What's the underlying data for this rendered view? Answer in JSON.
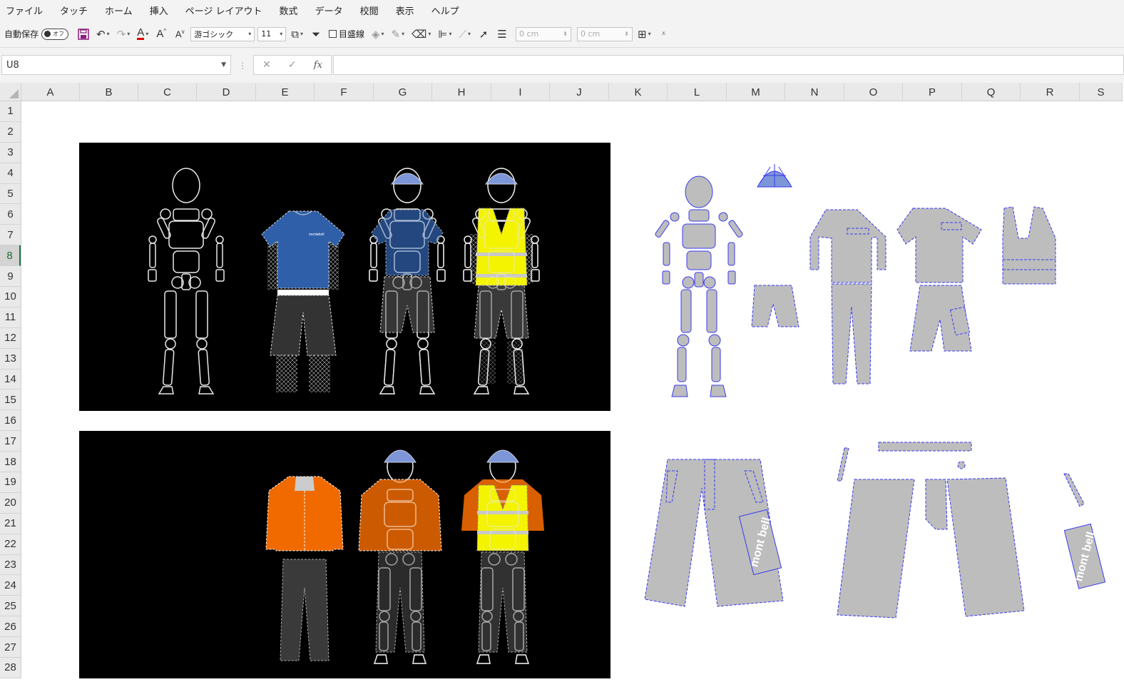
{
  "menu": {
    "items": [
      "ファイル",
      "タッチ",
      "ホーム",
      "挿入",
      "ページ レイアウト",
      "数式",
      "データ",
      "校閲",
      "表示",
      "ヘルプ"
    ]
  },
  "ribbon": {
    "autosave_label": "自動保存",
    "autosave_state": "オフ",
    "font_name": "游ゴシック",
    "font_size": "11",
    "gridlines_label": "目盛線",
    "width_value": "0 cm",
    "height_value": "0 cm",
    "font_color": "#e00000"
  },
  "formula_bar": {
    "name_box": "U8",
    "formula": ""
  },
  "grid": {
    "columns": [
      "A",
      "B",
      "C",
      "D",
      "E",
      "F",
      "G",
      "H",
      "I",
      "J",
      "K",
      "L",
      "M",
      "N",
      "O",
      "P",
      "Q",
      "R",
      "S"
    ],
    "rows": [
      "1",
      "2",
      "3",
      "4",
      "5",
      "6",
      "7",
      "8",
      "9",
      "10",
      "11",
      "12",
      "13",
      "14",
      "15",
      "16",
      "17",
      "18",
      "19",
      "20",
      "21",
      "22",
      "23",
      "24",
      "25",
      "26",
      "27",
      "28"
    ],
    "active_row": "8"
  },
  "drawings": {
    "brand_logo_text": "mont bell",
    "colors": {
      "panel_bg": "#000000",
      "tshirt_blue": "#2f5fa8",
      "jacket_orange": "#f06a00",
      "vest_yellow": "#f4f400",
      "pattern_gray": "#bdbdbd",
      "pattern_outline": "#3a3af0",
      "figure_outline": "#e8e8e8",
      "helmet_blue": "#7d96d8"
    }
  }
}
